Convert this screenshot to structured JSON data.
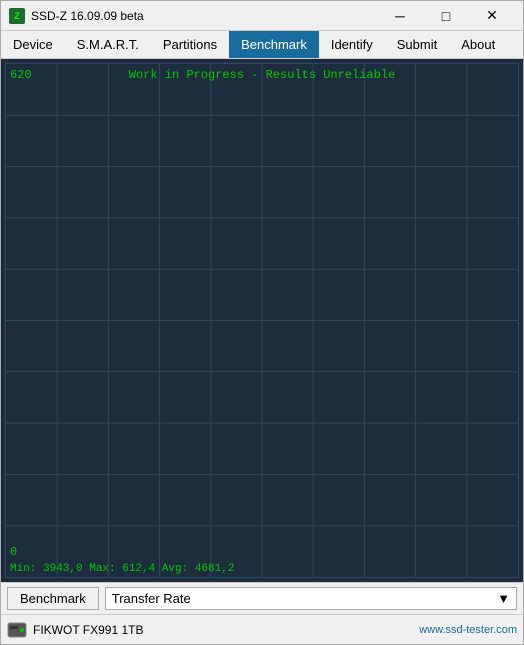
{
  "window": {
    "title": "SSD-Z 16.09.09 beta",
    "icon": "Z"
  },
  "titlebar": {
    "minimize": "─",
    "maximize": "□",
    "close": "✕"
  },
  "menu": {
    "items": [
      {
        "label": "Device",
        "active": false
      },
      {
        "label": "S.M.A.R.T.",
        "active": false
      },
      {
        "label": "Partitions",
        "active": false
      },
      {
        "label": "Benchmark",
        "active": true
      },
      {
        "label": "Identify",
        "active": false
      },
      {
        "label": "Submit",
        "active": false
      },
      {
        "label": "About",
        "active": false
      }
    ]
  },
  "chart": {
    "warning_text": "Work in Progress - Results Unreliable",
    "y_max": "620",
    "y_min": "0",
    "stats": "Min: 3943,0  Max: 612,4  Avg: 4681,2",
    "grid_color": "#2e4a5e",
    "line_color": "#00c800"
  },
  "toolbar": {
    "benchmark_label": "Benchmark",
    "dropdown_value": "Transfer Rate",
    "chevron": "▼"
  },
  "statusbar": {
    "drive_name": "FIKWOT FX991 1TB",
    "website": "www.ssd-tester.com"
  }
}
